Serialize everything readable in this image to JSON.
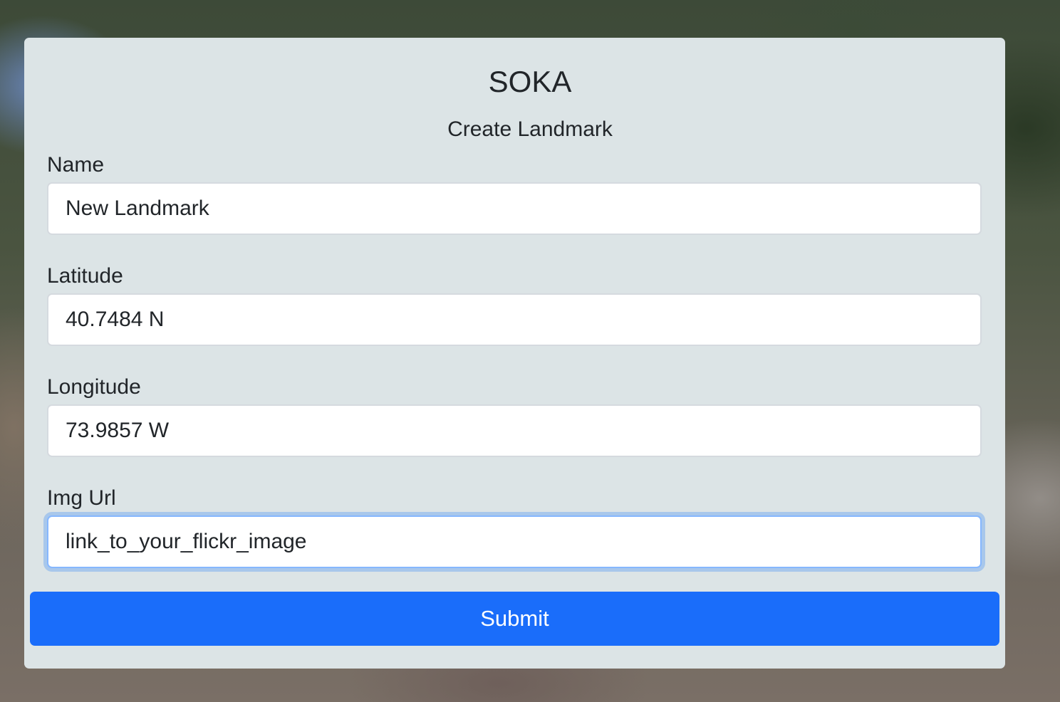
{
  "app": {
    "title": "SOKA",
    "subtitle": "Create Landmark"
  },
  "form": {
    "name": {
      "label": "Name",
      "value": "New Landmark"
    },
    "latitude": {
      "label": "Latitude",
      "value": "40.7484 N"
    },
    "longitude": {
      "label": "Longitude",
      "value": "73.9857 W"
    },
    "img_url": {
      "label": "Img Url",
      "value": "link_to_your_flickr_image"
    },
    "submit_label": "Submit"
  },
  "colors": {
    "card_background": "#dce4e6",
    "submit_button": "#1a6dfa",
    "focus_ring": "#86b7fe",
    "text": "#212529"
  }
}
